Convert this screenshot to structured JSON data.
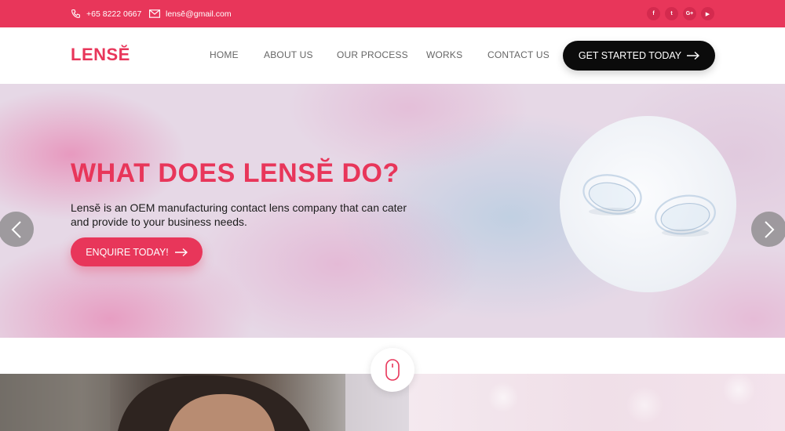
{
  "topbar": {
    "phone": "+65 8222 0667",
    "email": "lensĕ@gmail.com",
    "social_icons": [
      "facebook-icon",
      "twitter-icon",
      "google-plus-icon",
      "youtube-icon"
    ],
    "social_labels": [
      "f",
      "t",
      "G+",
      "▶"
    ]
  },
  "nav": {
    "logo": "LENSĔ",
    "items": [
      "HOME",
      "ABOUT US",
      "OUR PROCESS",
      "WORKS",
      "CONTACT US"
    ],
    "cta": "GET STARTED TODAY"
  },
  "hero": {
    "title": "WHAT DOES LENSĔ DO?",
    "description": "Lensĕ is an OEM manufacturing contact lens company that can cater and provide to your business needs.",
    "button": "ENQUIRE TODAY!"
  },
  "colors": {
    "brand": "#e8365a",
    "cta_dark": "#0b0b0b"
  }
}
